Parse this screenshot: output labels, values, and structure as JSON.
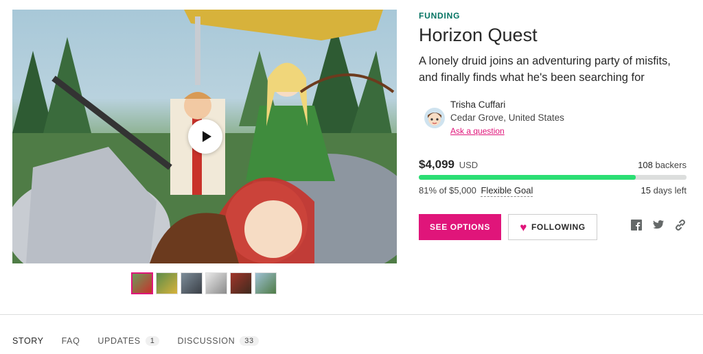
{
  "project": {
    "state_label": "FUNDING",
    "title": "Horizon Quest",
    "blurb": "A lonely druid joins an adventuring party of misfits, and finally finds what he's been searching for"
  },
  "creator": {
    "name": "Trisha Cuffari",
    "location": "Cedar Grove, United States",
    "ask_label": "Ask a question"
  },
  "stats": {
    "pledged": "$4,099",
    "currency": "USD",
    "backers_count": "108",
    "backers_label": "backers",
    "percent_funded": 81,
    "goal_text": "81% of $5,000",
    "goal_type": "Flexible Goal",
    "days_left_count": "15",
    "days_left_label": "days left"
  },
  "actions": {
    "see_options": "SEE OPTIONS",
    "following": "FOLLOWING"
  },
  "social": [
    "facebook-icon",
    "twitter-icon",
    "link-icon"
  ],
  "thumbnails_count": 6,
  "tabs": [
    {
      "label": "STORY",
      "count": ""
    },
    {
      "label": "FAQ",
      "count": ""
    },
    {
      "label": "UPDATES",
      "count": "1"
    },
    {
      "label": "DISCUSSION",
      "count": "33"
    }
  ],
  "colors": {
    "brand": "#e0157a",
    "funding_green": "#037362",
    "progress": "#2bde73"
  }
}
